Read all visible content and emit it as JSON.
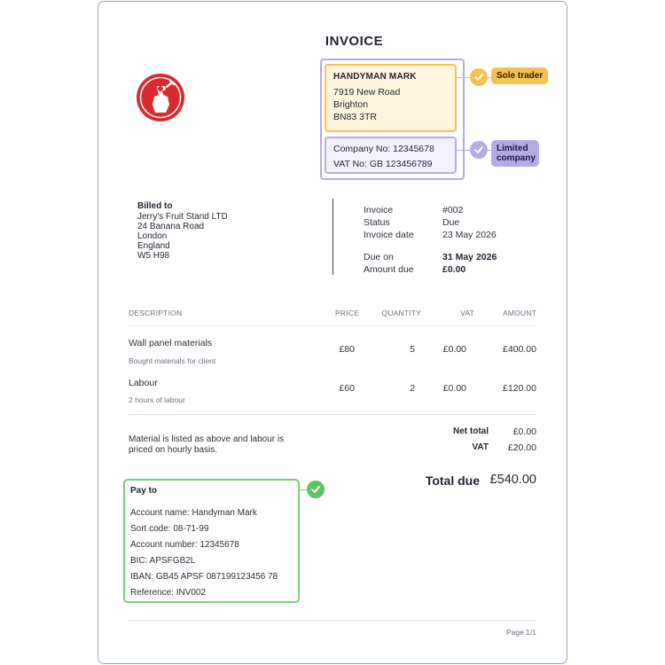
{
  "invoice": {
    "title": "INVOICE",
    "business": {
      "name": "HANDYMAN MARK",
      "address_lines": [
        "7919 New Road",
        "Brighton",
        "BN83 3TR"
      ],
      "company_no": "Company No: 12345678",
      "vat_no": "VAT No: GB 123456789",
      "tag_sole_trader": "Sole trader",
      "tag_limited": "Limited company"
    },
    "billed_to": {
      "heading": "Billed to",
      "lines": [
        "Jerry's Fruit Stand LTD",
        "24 Banana Road",
        "London",
        "England",
        "W5 H98"
      ]
    },
    "meta": {
      "invoice_label": "Invoice",
      "invoice_value": "#002",
      "status_label": "Status",
      "status_value": "Due",
      "date_label": "Invoice date",
      "date_value": "23 May 2026",
      "due_on_label": "Due on",
      "due_on_value": "31 May 2026",
      "amount_due_label": "Amount due",
      "amount_due_value": "£0.00"
    },
    "table": {
      "headers": {
        "description": "DESCRIPTION",
        "price": "PRICE",
        "quantity": "QUANTITY",
        "vat": "VAT",
        "amount": "AMOUNT"
      },
      "rows": [
        {
          "description": "Wall panel materials",
          "note": "Bought materials for client",
          "price": "£80",
          "quantity": "5",
          "vat": "£0.00",
          "amount": "£400.00"
        },
        {
          "description": "Labour",
          "note": "2 hours of labour",
          "price": "£60",
          "quantity": "2",
          "vat": "£0.00",
          "amount": "£120.00"
        }
      ]
    },
    "notes": "Material is listed as above and labour is priced on hourly basis.",
    "totals": {
      "net_total_label": "Net total",
      "net_total_value": "£0.00",
      "vat_label": "VAT",
      "vat_value": "£20.00",
      "total_due_label": "Total due",
      "total_due_value": "£540.00"
    },
    "pay_to": {
      "heading": "Pay to",
      "lines": [
        "Account name: Handyman Mark",
        "Sort code: 08-71-99",
        "Account number: 12345678",
        "BIC: APSFGB2L",
        "IBAN: GB45 APSF 087199123456 78",
        "Reference: INV002"
      ]
    },
    "footer": {
      "page": "Page 1/1"
    }
  },
  "colors": {
    "accent_yellow": "#f5c150",
    "accent_purple": "#b4abe6",
    "accent_green": "#5cc262",
    "logo_red": "#d92b2f",
    "page_border": "#8fa3cf"
  },
  "icons": {
    "logo": "handyman-logo-icon",
    "check": "check-circle-icon"
  }
}
